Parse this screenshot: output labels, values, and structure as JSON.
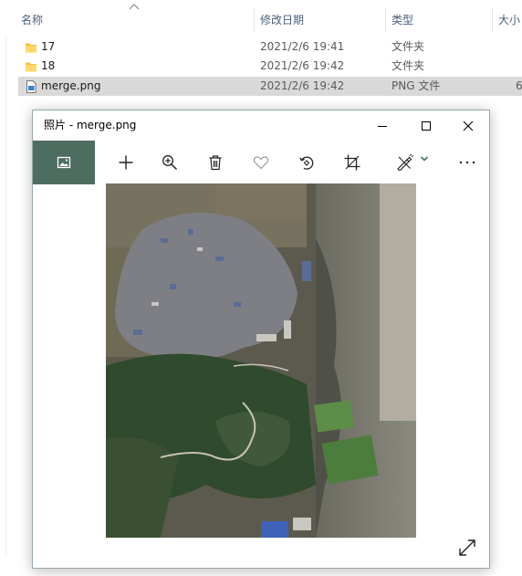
{
  "explorer": {
    "columns": {
      "name": "名称",
      "date": "修改日期",
      "type": "类型",
      "size": "大小"
    },
    "files": [
      {
        "name": "17",
        "date": "2021/2/6 19:41",
        "type": "文件夹",
        "size": "",
        "kind": "folder",
        "selected": false
      },
      {
        "name": "18",
        "date": "2021/2/6 19:42",
        "type": "文件夹",
        "size": "",
        "kind": "folder",
        "selected": false
      },
      {
        "name": "merge.png",
        "date": "2021/2/6 19:42",
        "type": "PNG 文件",
        "size": "6,",
        "kind": "png",
        "selected": true
      }
    ]
  },
  "photos": {
    "title": "照片 - merge.png",
    "toolbar": [
      "gallery-icon",
      "add-icon",
      "zoom-in-icon",
      "delete-icon",
      "favorite-icon",
      "rotate-icon",
      "crop-icon",
      "edit-icon",
      "more-icon"
    ],
    "colors": {
      "gallery_bg": "#4e6d61",
      "accent": "#4e6d61",
      "selection": "#d9d9d9"
    }
  }
}
